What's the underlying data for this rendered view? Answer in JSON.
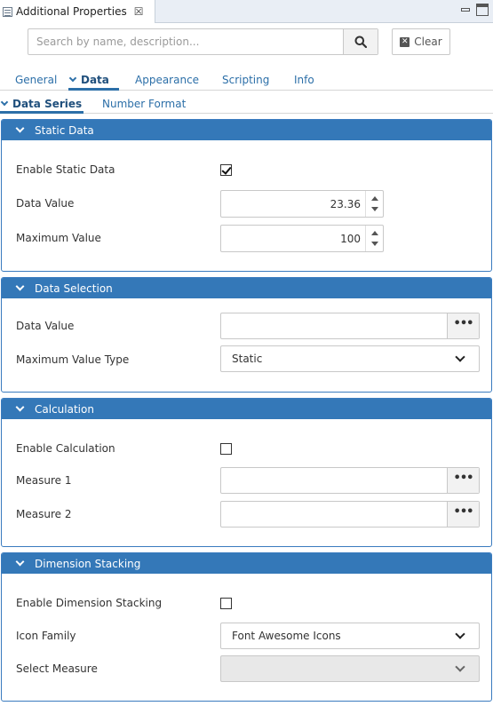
{
  "window": {
    "title": "Additional Properties",
    "close_glyph": "☒",
    "icon": "properties-view-icon"
  },
  "search": {
    "placeholder": "Search by name, description...",
    "value": "",
    "clear_label": "Clear"
  },
  "tabs": {
    "main": [
      "General",
      "Data",
      "Appearance",
      "Scripting",
      "Info"
    ],
    "active_main": "Data",
    "sub": [
      "Data Series",
      "Number Format"
    ],
    "active_sub": "Data Series"
  },
  "sections": {
    "static_data": {
      "title": "Static Data",
      "enable_label": "Enable Static Data",
      "enable_checked": true,
      "data_value_label": "Data Value",
      "data_value": "23.36",
      "max_value_label": "Maximum Value",
      "max_value": "100"
    },
    "data_selection": {
      "title": "Data Selection",
      "data_value_label": "Data Value",
      "data_value": "",
      "picker_glyph": "•••",
      "max_type_label": "Maximum Value Type",
      "max_type_value": "Static"
    },
    "calculation": {
      "title": "Calculation",
      "enable_label": "Enable Calculation",
      "enable_checked": false,
      "measure1_label": "Measure 1",
      "measure1_value": "",
      "measure2_label": "Measure 2",
      "measure2_value": "",
      "picker_glyph": "•••"
    },
    "dimension_stacking": {
      "title": "Dimension Stacking",
      "enable_label": "Enable Dimension Stacking",
      "enable_checked": false,
      "icon_family_label": "Icon Family",
      "icon_family_value": "Font Awesome Icons",
      "select_measure_label": "Select Measure",
      "select_measure_value": ""
    }
  },
  "colors": {
    "section_header": "#3478b8",
    "tab_text": "#2c6fa8"
  }
}
